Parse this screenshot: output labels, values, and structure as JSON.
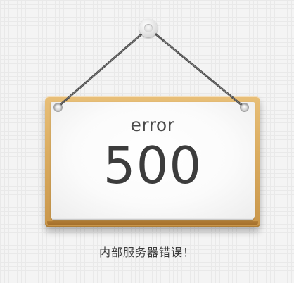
{
  "sign": {
    "title": "error",
    "code": "500"
  },
  "message": "内部服务器错误！",
  "icons": {
    "nail": "nail-icon"
  },
  "colors": {
    "background": "#f4f4f4",
    "board": "#dcae62",
    "paper": "#ffffff",
    "text": "#3c3c3c",
    "string": "#4a4a4a"
  }
}
